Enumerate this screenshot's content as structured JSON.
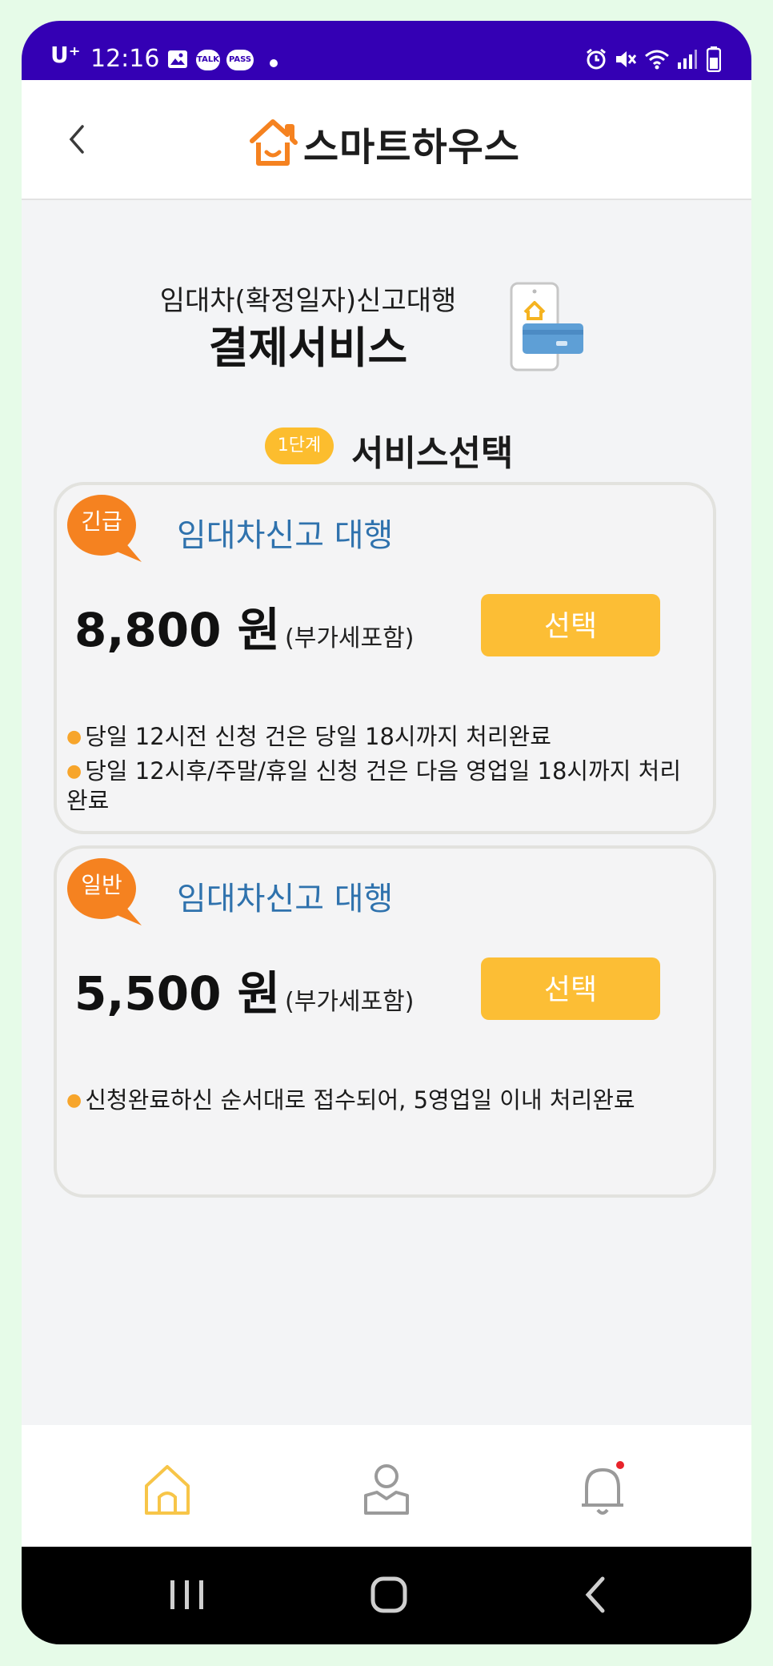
{
  "status_bar": {
    "carrier": "U⁺",
    "time": "12:16",
    "notif_icons": [
      "image-icon",
      "talk-icon",
      "pass-icon"
    ],
    "pill_talk": "TALK",
    "pill_pass": "PASS",
    "system_icons": [
      "alarm-icon",
      "mute-icon",
      "wifi-icon",
      "signal-icon",
      "battery-icon"
    ]
  },
  "header": {
    "back_icon": "chevron-left-icon",
    "logo_text": "스마트하우스"
  },
  "intro": {
    "subtitle": "임대차(확정일자)신고대행",
    "title": "결제서비스"
  },
  "step": {
    "badge": "1단계",
    "title": "서비스선택"
  },
  "services": [
    {
      "tag": "긴급",
      "title": "임대차신고 대행",
      "price": "8,800 원",
      "vat": "(부가세포함)",
      "button": "선택",
      "notes": [
        "당일 12시전 신청 건은 당일 18시까지 처리완료",
        "당일 12시후/주말/휴일 신청 건은 다음 영업일 18시까지 처리완료"
      ]
    },
    {
      "tag": "일반",
      "title": "임대차신고 대행",
      "price": "5,500 원",
      "vat": "(부가세포함)",
      "button": "선택",
      "notes": [
        "신청완료하신 순서대로 접수되어, 5영업일 이내 처리완료"
      ]
    }
  ],
  "bottom_nav": {
    "items": [
      "home-icon",
      "profile-icon",
      "bell-icon"
    ],
    "active": "home-icon"
  },
  "colors": {
    "status_bar": "#3400b4",
    "accent_orange": "#f58220",
    "button_yellow": "#fcbe35",
    "title_blue": "#2f72ad"
  }
}
